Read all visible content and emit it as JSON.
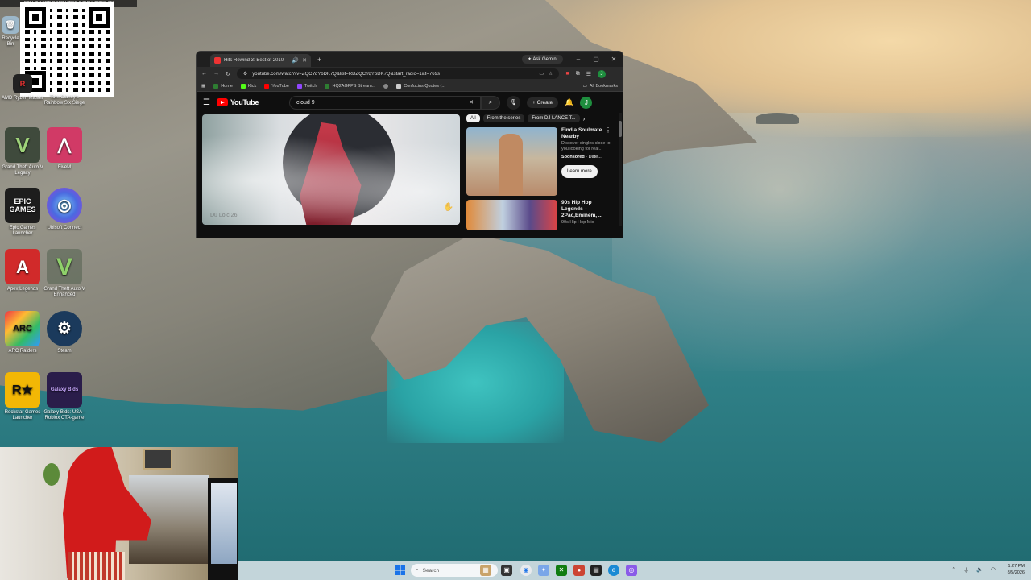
{
  "overlay": {
    "top_strip_text": "FOLLOW FOR GOOD VIBES & CHILL PICKS  150"
  },
  "desktop": {
    "icons": [
      {
        "label": "Recycle Bin",
        "icon": "recycle-bin-icon"
      },
      {
        "label": "AMD Ryzen Master",
        "icon": "amd-ryzen-master-icon"
      },
      {
        "label": "Tom Clancy's Rainbow Six Siege",
        "icon": "rainbow-six-siege-icon"
      },
      {
        "label": "Grand Theft Auto V Legacy",
        "icon": "gta-v-icon",
        "glyph": "V"
      },
      {
        "label": "FiveM",
        "icon": "fivem-icon",
        "glyph": "⋀"
      },
      {
        "label": "Epic Games Launcher",
        "icon": "epic-games-icon",
        "glyph": "EPIC\nGAMES"
      },
      {
        "label": "Ubisoft Connect",
        "icon": "ubisoft-connect-icon",
        "glyph": "◎"
      },
      {
        "label": "Apex Legends",
        "icon": "apex-legends-icon",
        "glyph": "A"
      },
      {
        "label": "Grand Theft Auto V Enhanced",
        "icon": "gta-v-enhanced-icon",
        "glyph": "V"
      },
      {
        "label": "ARC Raiders",
        "icon": "arc-raiders-icon",
        "glyph": "ARC"
      },
      {
        "label": "Steam",
        "icon": "steam-icon",
        "glyph": "⚙"
      },
      {
        "label": "Rockstar Games Launcher",
        "icon": "rockstar-games-icon",
        "glyph": "R★"
      },
      {
        "label": "Galaxy Bids: USA - Roblox CTA-game",
        "icon": "galaxy-bids-icon",
        "glyph": "Galaxy Bids"
      }
    ]
  },
  "browser": {
    "tab_title": "Hits Rewind 3: Best of 2010",
    "ask_gemini": "Ask Gemini",
    "url": "youtube.com/watch?v=ZQCYqYbDK7Q&list=RDZQCYqYbDK7Q&start_radio=1&t=769s",
    "profile_initial": "J",
    "bookmarks": [
      {
        "label": "Home",
        "color": "#2e7d32"
      },
      {
        "label": "Kick",
        "color": "#53fc18"
      },
      {
        "label": "YouTube",
        "color": "#ff0000"
      },
      {
        "label": "Twitch",
        "color": "#9146ff"
      },
      {
        "label": "HQ2AGFPS Stream...",
        "color": "#2e7d32"
      },
      {
        "label": "",
        "color": "#888888"
      },
      {
        "label": "Confucius Quotes (...",
        "color": "#cccccc"
      }
    ],
    "all_bookmarks": "All Bookmarks"
  },
  "youtube": {
    "logo_text": "YouTube",
    "search_value": "cloud 9",
    "create_label": "Create",
    "avatar_initial": "J",
    "video_caption": "Du Loic 26",
    "chips": [
      "All",
      "From the series",
      "From DJ LANCE T..."
    ],
    "ad": {
      "title": "Find a Soulmate Nearby",
      "description": "Discover singles close to you looking for real...",
      "sponsored_label": "Sponsored",
      "sponsor": "Date...",
      "cta": "Learn more"
    },
    "next_video": {
      "title": "90s Hip Hop Legends – 2Pac,Eminem, ...",
      "subtitle": "90s Hip Hop Mix"
    }
  },
  "taskbar": {
    "search_placeholder": "Search",
    "time": "1:27 PM",
    "date": "8/5/2026"
  }
}
